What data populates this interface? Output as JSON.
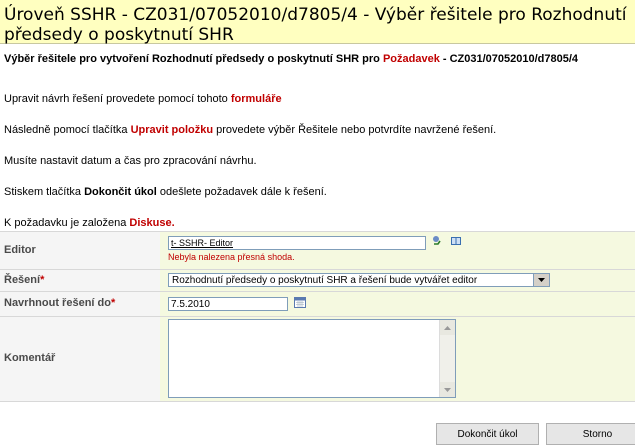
{
  "title": "Úroveň SSHR - CZ031/07052010/d7805/4 - Výběr řešitele pro Rozhodnutí předsedy o poskytnutí SHR",
  "intro": {
    "prefix": "Výběr řešitele pro vytvoření Rozhodnutí předsedy o poskytnutí SHR pro ",
    "link": "Požadavek",
    "suffix": " - CZ031/07052010/d7805/4"
  },
  "para1": {
    "text": "Upravit návrh řešení provedete pomocí tohoto ",
    "link": "formuláře"
  },
  "para2": {
    "prefix": "Následně pomocí tlačítka ",
    "link": "Upravit položku",
    "suffix": " provedete výběr Řešitele nebo potvrdíte navržené řešení."
  },
  "para3": {
    "text": "Musíte nastavit datum a čas pro zpracování návrhu."
  },
  "para4": {
    "prefix": "Stiskem tlačítka ",
    "bold": "Dokončit úkol",
    "suffix": " odešlete požadavek dále k řešení."
  },
  "para5": {
    "prefix": "K požadavku je založena ",
    "link": "Diskuse."
  },
  "form": {
    "editor": {
      "label": "Editor",
      "value": "t- SSHR- Editor",
      "error": "Nebyla nalezena přesná shoda."
    },
    "reseni": {
      "label": "Řešení",
      "required": "*",
      "value": "Rozhodnutí předsedy o poskytnutí SHR a řešení bude vytvářet editor"
    },
    "date": {
      "label": "Navrhnout řešení do",
      "required": "*",
      "value": "7.5.2010"
    },
    "comment": {
      "label": "Komentář",
      "value": ""
    }
  },
  "buttons": {
    "finish": "Dokončit úkol",
    "cancel": "Storno"
  },
  "colors": {
    "title_bg": "#ffffc0",
    "accent_red": "#c00000",
    "field_bg": "#f5f9e0"
  }
}
